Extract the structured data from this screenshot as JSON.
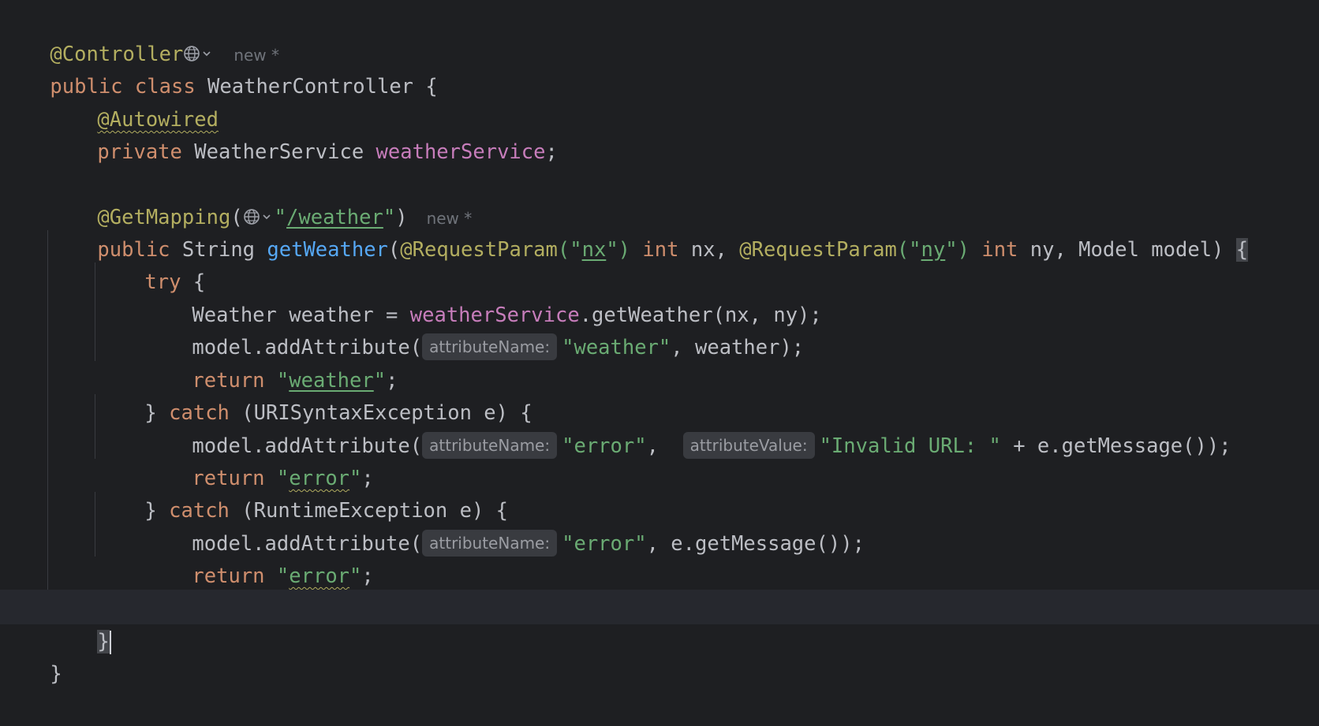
{
  "code": {
    "l1": {
      "annotation": "@Controller",
      "badge": "new *",
      "globe_icon": "globe-icon"
    },
    "l2": {
      "kw1": "public",
      "kw2": "class",
      "name": "WeatherController",
      "brace": "{"
    },
    "l3": {
      "annotation": "@Autowired"
    },
    "l4": {
      "kw": "private",
      "type": "WeatherService",
      "field": "weatherService",
      "semi": ";"
    },
    "l6": {
      "annotation": "@GetMapping",
      "open": "(",
      "quote_open": "\"",
      "path": "/weather",
      "quote_close": "\"",
      "close": ")",
      "badge": "new *"
    },
    "l7": {
      "kw": "public",
      "type": "String",
      "method": "getWeather",
      "open": "(",
      "ann1": "@RequestParam",
      "p1_open": "(\"",
      "p1_val": "nx",
      "p1_close": "\")",
      "int1": "int",
      "arg1": "nx,",
      "ann2": "@RequestParam",
      "p2_open": "(\"",
      "p2_val": "ny",
      "p2_close": "\")",
      "int2": "int",
      "arg2": "ny, Model model)",
      "brace": "{"
    },
    "l8": {
      "kw": "try",
      "brace": "{"
    },
    "l9": {
      "pre": "Weather weather = ",
      "field": "weatherService",
      "post": ".getWeather(nx, ny);"
    },
    "l10": {
      "pre": "model.addAttribute(",
      "hint": "attributeName:",
      "str": "\"weather\"",
      "post": ", weather);"
    },
    "l11": {
      "kw": "return",
      "q1": "\"",
      "val": "weather",
      "q2": "\"",
      "semi": ";"
    },
    "l12": {
      "pre": "} ",
      "kw": "catch",
      "post": " (URISyntaxException e) {"
    },
    "l13": {
      "pre": "model.addAttribute(",
      "hint1": "attributeName:",
      "str1": "\"error\"",
      "comma": ",",
      "hint2": "attributeValue:",
      "str2": "\"Invalid URL: \"",
      "post": " + e.getMessage());"
    },
    "l14": {
      "kw": "return",
      "q1": "\"",
      "val": "error",
      "q2": "\"",
      "semi": ";"
    },
    "l15": {
      "pre": "} ",
      "kw": "catch",
      "post": " (RuntimeException e) {"
    },
    "l16": {
      "pre": "model.addAttribute(",
      "hint": "attributeName:",
      "str": "\"error\"",
      "post": ", e.getMessage());"
    },
    "l17": {
      "kw": "return",
      "q1": "\"",
      "val": "error",
      "q2": "\"",
      "semi": ";"
    },
    "l18": {
      "brace": "}"
    },
    "l19": {
      "brace": "}"
    },
    "l20": {
      "brace": "}"
    }
  }
}
